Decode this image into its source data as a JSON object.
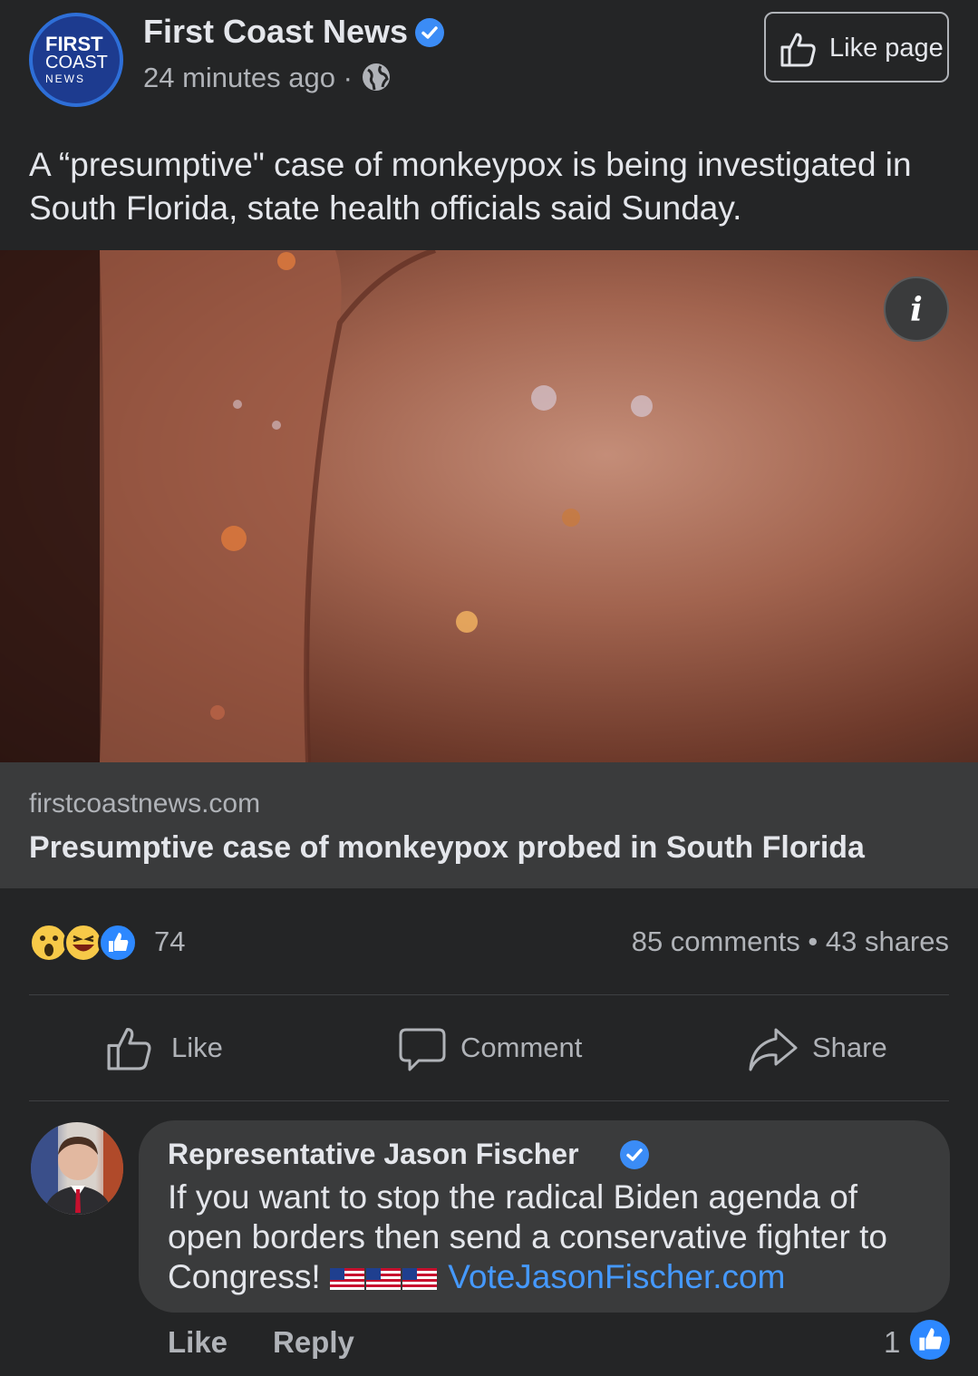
{
  "post": {
    "page_name": "First Coast News",
    "avatar_logo": {
      "line1": "FIRST",
      "line2": "COAST",
      "line3": "NEWS"
    },
    "time": "24 minutes ago ·",
    "like_page_label": "Like page",
    "text": "A “presumptive\" case of monkeypox is being investigated in South Florida, state health officials said Sunday.",
    "link_domain": "firstcoastnews.com",
    "link_title": "Presumptive case of monkeypox probed in South Florida",
    "reaction_count": "74",
    "comments_shares": "85 comments • 43 shares",
    "actions": {
      "like": "Like",
      "comment": "Comment",
      "share": "Share"
    }
  },
  "comment": {
    "author": "Representative Jason Fischer",
    "text": "If you want to stop the radical Biden agenda of open borders then send a conservative fighter to Congress! ",
    "link": "VoteJasonFischer.com",
    "like_label": "Like",
    "reply_label": "Reply",
    "like_count": "1"
  },
  "icons": [
    "verified-badge-icon",
    "globe-icon",
    "thumbs-up-icon",
    "info-icon",
    "wow-reaction-icon",
    "haha-reaction-icon",
    "like-reaction-icon",
    "comment-icon",
    "share-icon",
    "us-flag-icon"
  ],
  "colors": {
    "background": "#242526",
    "surface": "#3a3b3c",
    "accent": "#2d88ff",
    "link": "#4599ff",
    "text": "#e4e6eb",
    "muted": "#b0b3b8"
  }
}
